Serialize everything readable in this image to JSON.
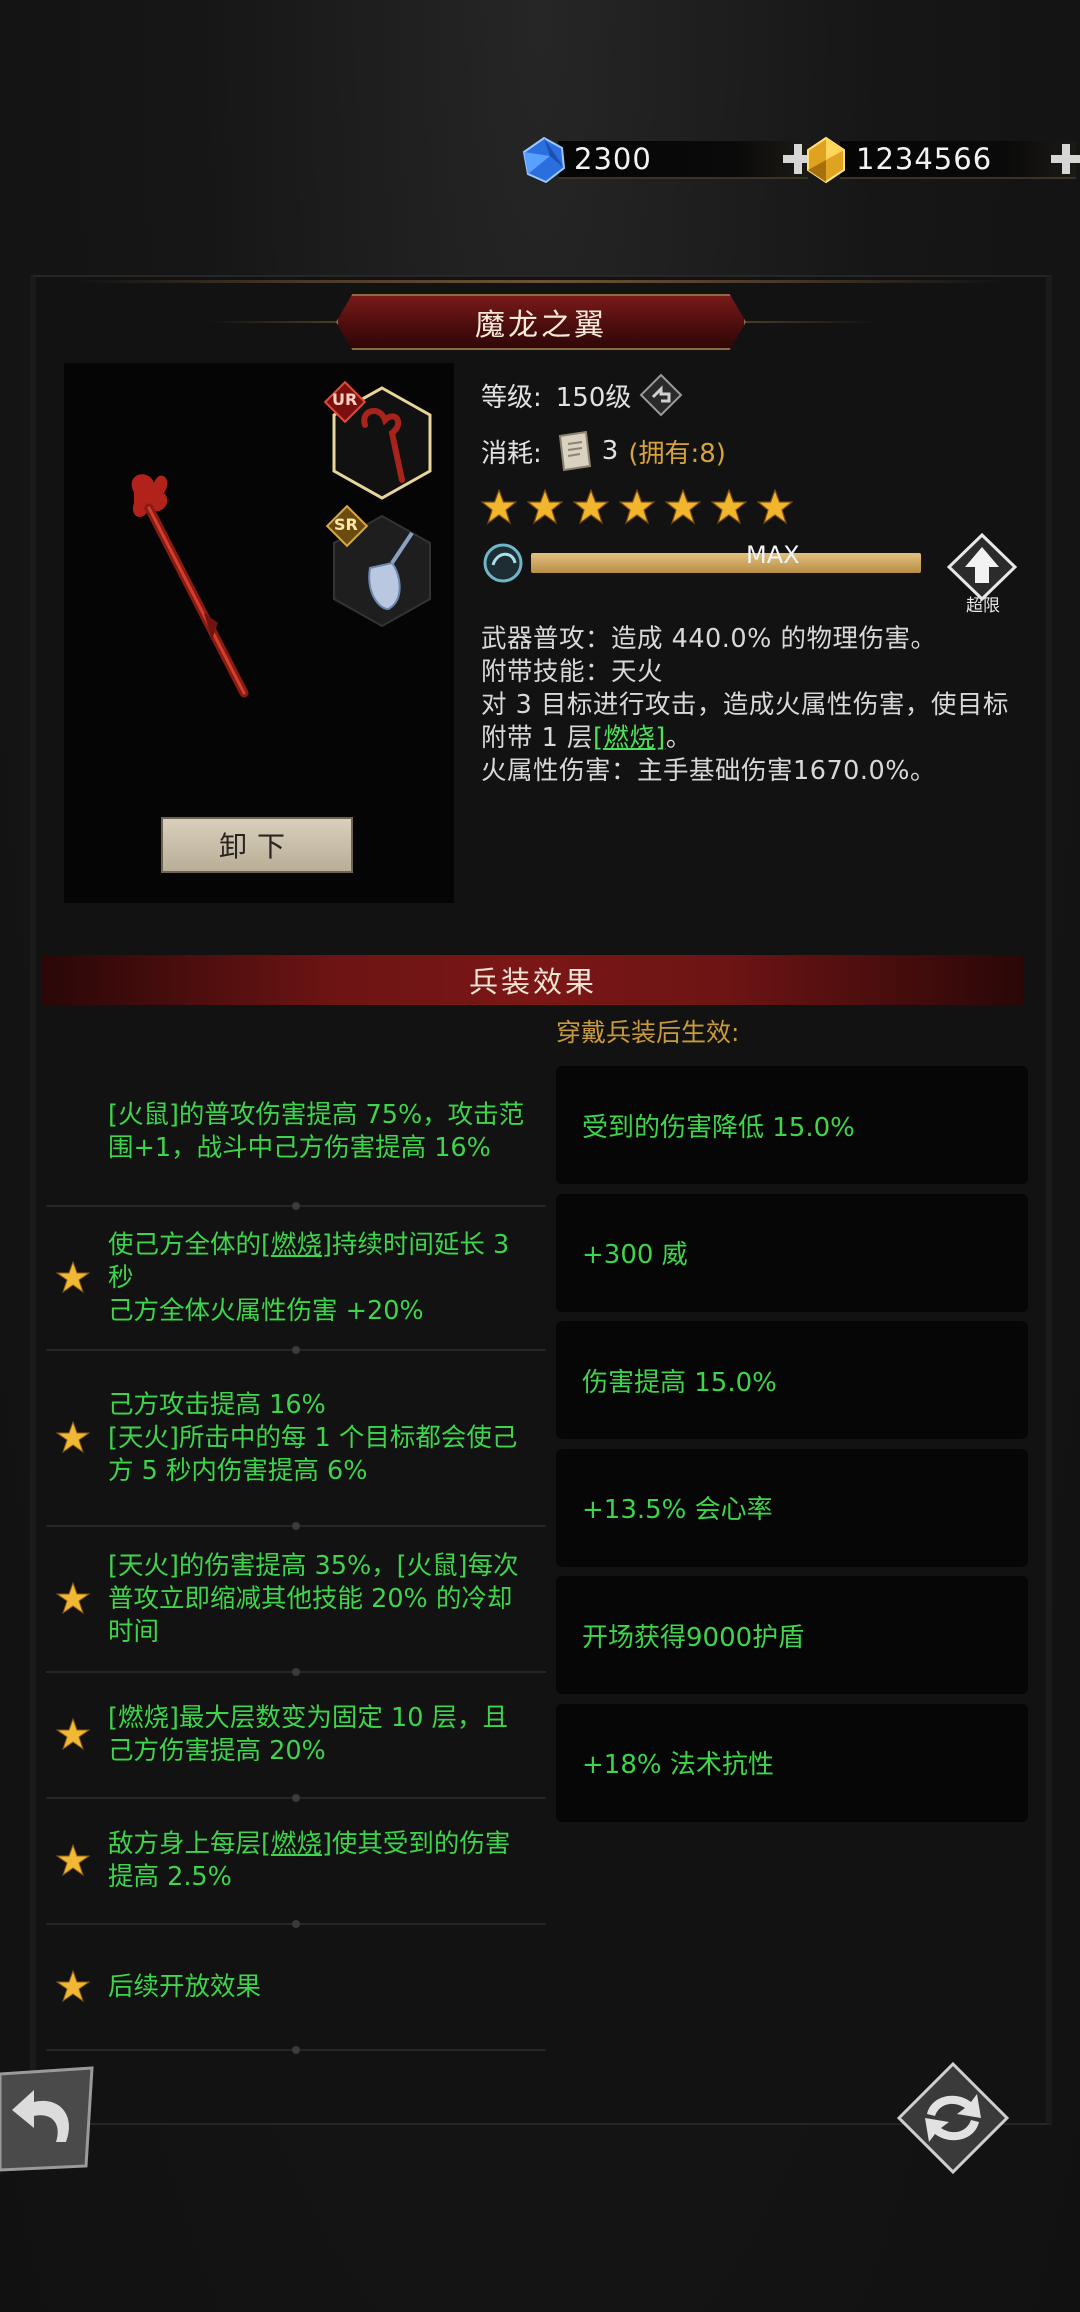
{
  "currency": {
    "diamonds": {
      "value": "2300",
      "icon": "blue-crystal-icon"
    },
    "gold": {
      "value": "1234566",
      "icon": "gold-crystal-icon"
    }
  },
  "weapon": {
    "title": "魔龙之翼",
    "level_label": "等级:",
    "level_value": "150级",
    "cost_label": "消耗:",
    "cost_amount": "3",
    "owned": "(拥有:8)",
    "stars": 7,
    "xp_text": "MAX",
    "xp_fraction": 1.0,
    "breakthrough_label": "超限",
    "rarity_ur": "UR",
    "rarity_sr": "SR",
    "unequip_label": "卸下",
    "desc": {
      "line1": "武器普攻：造成 440.0% 的物理伤害。",
      "line2": "附带技能：天火",
      "line3_pre": "对 3 目标进行攻击，造成火属性伤害，使目标附带 1 层",
      "line3_link": "[燃烧]",
      "line3_post": "。",
      "line4": "火属性伤害：主手基础伤害1670.0%。"
    }
  },
  "effects": {
    "header": "兵装效果",
    "wear_title": "穿戴兵装后生效:",
    "items": [
      {
        "starred": false,
        "text": "[火鼠]的普攻伤害提高 75%，攻击范围+1，战斗中己方伤害提高 16%"
      },
      {
        "starred": true,
        "pre": "使己方全体的",
        "link": "[燃烧]",
        "post": "持续时间延长 3 秒",
        "text2": "己方全体火属性伤害 +20%"
      },
      {
        "starred": true,
        "text": "己方攻击提高 16%",
        "text2": "[天火]所击中的每 1 个目标都会使己方 5 秒内伤害提高 6%"
      },
      {
        "starred": true,
        "text": "[天火]的伤害提高 35%，[火鼠]每次普攻立即缩减其他技能 20% 的冷却时间"
      },
      {
        "starred": true,
        "text": "[燃烧]最大层数变为固定 10 层，且己方伤害提高 20%"
      },
      {
        "starred": true,
        "pre": "敌方身上每层",
        "link": "[燃烧]",
        "post": "使其受到的伤害提高 2.5%"
      },
      {
        "starred": true,
        "text": "后续开放效果"
      }
    ],
    "bonuses": [
      "受到的伤害降低 15.0%",
      "+300 威",
      "伤害提高 15.0%",
      "+13.5% 会心率",
      "开场获得9000护盾",
      "+18% 法术抗性"
    ]
  },
  "colors": {
    "effect_green": "#3ed44b",
    "gold_text": "#c89a3b",
    "banner_red": "#6d1414"
  }
}
